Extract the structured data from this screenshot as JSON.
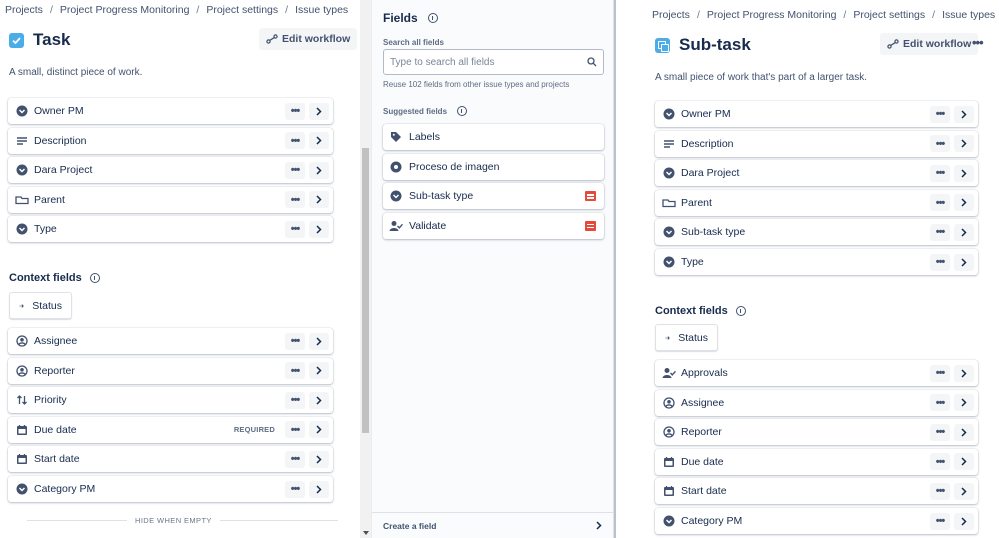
{
  "breadcrumbs": [
    "Projects",
    "Project Progress Monitoring",
    "Project settings",
    "Issue types"
  ],
  "left": {
    "title": "Task",
    "edit_workflow": "Edit workflow",
    "description": "A small, distinct piece of work.",
    "fields": [
      {
        "label": "Owner PM",
        "icon": "dropdown-icon"
      },
      {
        "label": "Description",
        "icon": "paragraph-icon"
      },
      {
        "label": "Dara Project",
        "icon": "dropdown-icon"
      },
      {
        "label": "Parent",
        "icon": "parent-icon"
      },
      {
        "label": "Type",
        "icon": "dropdown-icon"
      }
    ],
    "context_title": "Context fields",
    "status": "Status",
    "context_fields": [
      {
        "label": "Assignee",
        "icon": "user-icon"
      },
      {
        "label": "Reporter",
        "icon": "user-icon"
      },
      {
        "label": "Priority",
        "icon": "priority-icon"
      },
      {
        "label": "Due date",
        "icon": "calendar-icon",
        "badge": "REQUIRED"
      },
      {
        "label": "Start date",
        "icon": "calendar-icon"
      },
      {
        "label": "Category PM",
        "icon": "dropdown-icon"
      }
    ],
    "hide_when_empty": "HIDE WHEN EMPTY"
  },
  "middle": {
    "title": "Fields",
    "search_label": "Search all fields",
    "search_placeholder": "Type to search all fields",
    "reuse_text": "Reuse 102 fields from other issue types and projects",
    "suggested_title": "Suggested fields",
    "suggested": [
      {
        "label": "Labels",
        "icon": "label-icon"
      },
      {
        "label": "Proceso de imagen",
        "icon": "radio-icon"
      },
      {
        "label": "Sub-task type",
        "icon": "dropdown-icon",
        "app": true
      },
      {
        "label": "Validate",
        "icon": "user-check-icon",
        "app": true
      }
    ],
    "create_field": "Create a field"
  },
  "right": {
    "title": "Sub-task",
    "edit_workflow": "Edit workflow",
    "description": "A small piece of work that's part of a larger task.",
    "fields": [
      {
        "label": "Owner PM",
        "icon": "dropdown-icon"
      },
      {
        "label": "Description",
        "icon": "paragraph-icon"
      },
      {
        "label": "Dara Project",
        "icon": "dropdown-icon"
      },
      {
        "label": "Parent",
        "icon": "parent-icon"
      },
      {
        "label": "Sub-task type",
        "icon": "dropdown-icon"
      },
      {
        "label": "Type",
        "icon": "dropdown-icon"
      }
    ],
    "context_title": "Context fields",
    "status": "Status",
    "context_fields": [
      {
        "label": "Approvals",
        "icon": "user-check-icon"
      },
      {
        "label": "Assignee",
        "icon": "user-icon"
      },
      {
        "label": "Reporter",
        "icon": "user-icon"
      },
      {
        "label": "Due date",
        "icon": "calendar-icon"
      },
      {
        "label": "Start date",
        "icon": "calendar-icon"
      },
      {
        "label": "Category PM",
        "icon": "dropdown-icon"
      }
    ]
  },
  "colors": {
    "accent": "#4bade8",
    "app_badge": "#e5493a",
    "text": "#172b4d"
  }
}
